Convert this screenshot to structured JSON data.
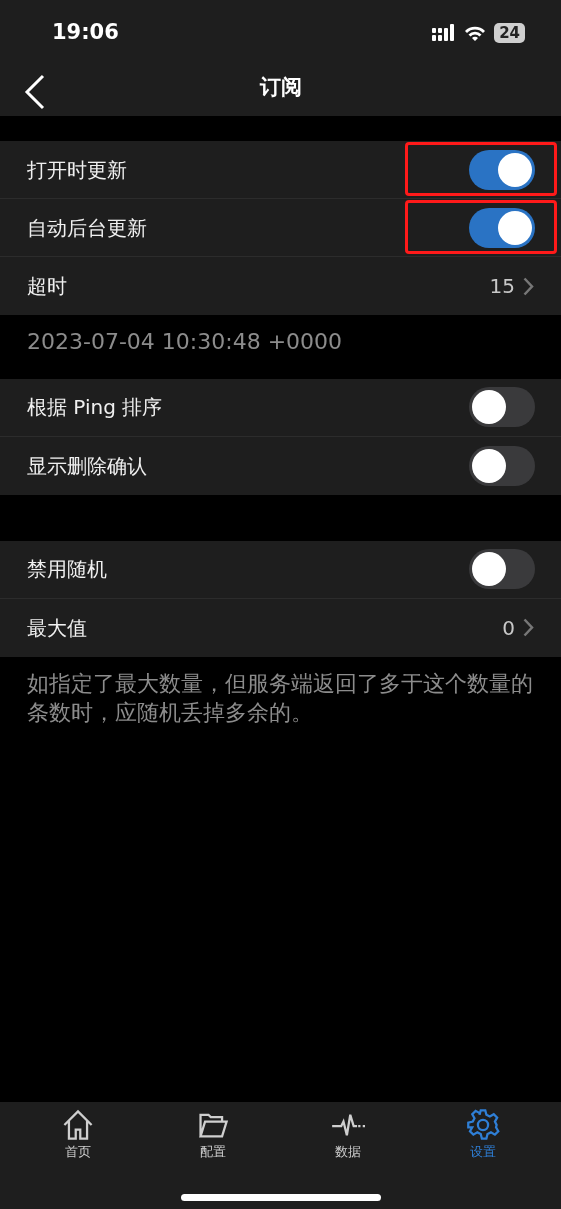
{
  "status_bar": {
    "time": "19:06",
    "battery": "24"
  },
  "nav": {
    "title": "订阅"
  },
  "sections": [
    {
      "rows": [
        {
          "kind": "toggle",
          "label": "打开时更新",
          "on": true,
          "highlighted": true
        },
        {
          "kind": "toggle",
          "label": "自动后台更新",
          "on": true,
          "highlighted": true
        },
        {
          "kind": "value",
          "label": "超时",
          "value": "15"
        }
      ],
      "footer": "2023-07-04 10:30:48 +0000"
    },
    {
      "rows": [
        {
          "kind": "toggle",
          "label": "根据 Ping 排序",
          "on": false,
          "highlighted": false
        },
        {
          "kind": "toggle",
          "label": "显示删除确认",
          "on": false,
          "highlighted": false
        }
      ]
    },
    {
      "rows": [
        {
          "kind": "toggle",
          "label": "禁用随机",
          "on": false,
          "highlighted": false
        },
        {
          "kind": "value",
          "label": "最大值",
          "value": "0"
        }
      ],
      "footer": "如指定了最大数量，但服务端返回了多于这个数量的条数时，应随机丢掉多余的。"
    }
  ],
  "tabs": [
    {
      "label": "首页",
      "selected": false
    },
    {
      "label": "配置",
      "selected": false
    },
    {
      "label": "数据",
      "selected": false
    },
    {
      "label": "设置",
      "selected": true
    }
  ]
}
